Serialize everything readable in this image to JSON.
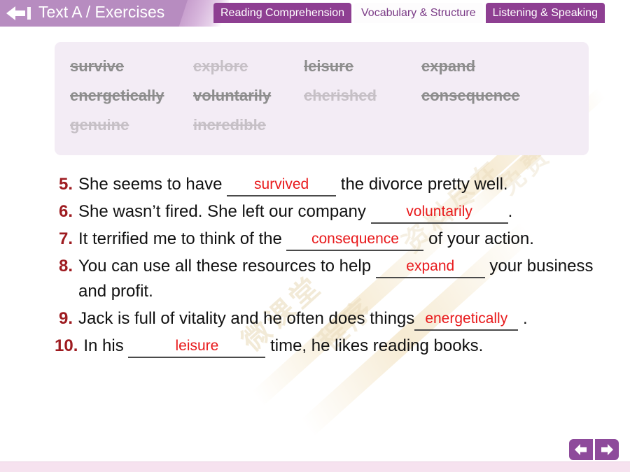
{
  "header": {
    "back_icon": "back-arrow-icon",
    "title": "Text A / Exercises",
    "tabs": [
      {
        "label": "Reading Comprehension",
        "active": false
      },
      {
        "label": "Vocabulary & Structure",
        "active": true
      },
      {
        "label": "Listening & Speaking",
        "active": false
      }
    ]
  },
  "word_bank": {
    "words": [
      {
        "text": "survive",
        "used": true
      },
      {
        "text": "explore",
        "used": false
      },
      {
        "text": "leisure",
        "used": true
      },
      {
        "text": "expand",
        "used": true
      },
      {
        "text": "energetically",
        "used": true
      },
      {
        "text": "voluntarily",
        "used": true
      },
      {
        "text": "cherished",
        "used": false
      },
      {
        "text": "consequence",
        "used": true
      },
      {
        "text": "genuine",
        "used": false
      },
      {
        "text": "incredible",
        "used": false
      }
    ]
  },
  "exercises": [
    {
      "number": "5.",
      "pre": "She seems to have ",
      "answer": "survived",
      "post": " the divorce pretty well."
    },
    {
      "number": "6.",
      "pre": "She wasn’t fired. She left our company ",
      "answer": "voluntarily",
      "post": "."
    },
    {
      "number": "7.",
      "pre": "It terrified me to think of the ",
      "answer": "consequence",
      "post": " of your action."
    },
    {
      "number": "8.",
      "pre": "You can use all these resources to help ",
      "answer": "expand",
      "post": " your business and profit."
    },
    {
      "number": "9.",
      "pre": "Jack is full of vitality and he often does things",
      "answer": "energetically",
      "post": " ."
    },
    {
      "number": "10.",
      "pre": "In his ",
      "answer": "leisure",
      "post": " time, he likes reading books."
    }
  ],
  "footer": {
    "prev_icon": "arrow-left-icon",
    "next_icon": "arrow-right-icon"
  },
  "watermark": {
    "line1": "微课堂",
    "line2": "程序",
    "line3": "资料尽在",
    "line4": "免费"
  },
  "colors": {
    "header_band": "#b78cc0",
    "tab_inactive": "#8e3f92",
    "tab_active_text": "#7a3a86",
    "word_bank_bg": "#f3ecf5",
    "answer_red": "#e8191b",
    "number_red": "#9e1b20",
    "nav_purple": "#8e4b9b",
    "footer_pink": "#f6e2ef"
  }
}
